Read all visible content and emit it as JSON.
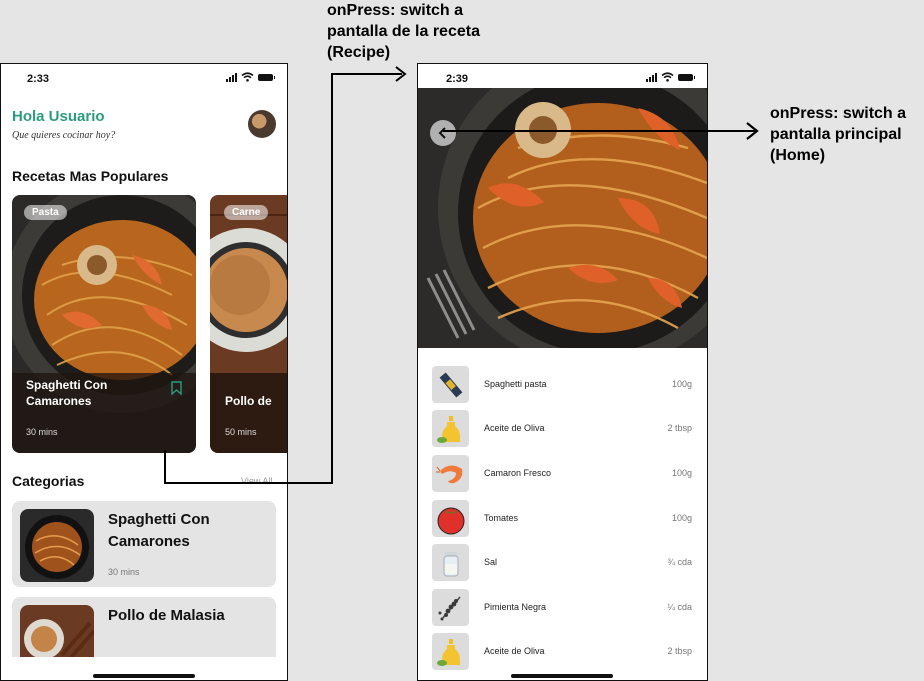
{
  "annotations": {
    "to_recipe": "onPress: switch a pantalla de la receta (Recipe)",
    "to_home": "onPress: switch a pantalla principal (Home)"
  },
  "home": {
    "status_time": "2:33",
    "greeting": "Hola Usuario",
    "subtitle": "Que quieres cocinar hoy?",
    "popular_title": "Recetas Mas Populares",
    "cards": [
      {
        "tag": "Pasta",
        "title": "Spaghetti Con Camarones",
        "time": "30 mins"
      },
      {
        "tag": "Carne",
        "title": "Pollo de",
        "time": "50 mins"
      }
    ],
    "categories_title": "Categorias",
    "view_all": "View All",
    "category_items": [
      {
        "title": "Spaghetti Con Camarones",
        "time": "30 mins"
      },
      {
        "title": "Pollo de Malasia",
        "time": ""
      }
    ]
  },
  "recipe": {
    "status_time": "2:39",
    "ingredients": [
      {
        "name": "Spaghetti pasta",
        "qty": "100g",
        "icon": "pasta-package-icon"
      },
      {
        "name": "Aceite de Oliva",
        "qty": "2 tbsp",
        "icon": "olive-oil-icon"
      },
      {
        "name": "Camaron Fresco",
        "qty": "100g",
        "icon": "shrimp-icon"
      },
      {
        "name": "Tomates",
        "qty": "100g",
        "icon": "tomato-icon"
      },
      {
        "name": "Sal",
        "qty": "¾ cda",
        "icon": "salt-icon"
      },
      {
        "name": "Pimienta Negra",
        "qty": "¼ cda",
        "icon": "pepper-icon"
      },
      {
        "name": "Aceite de Oliva",
        "qty": "2 tbsp",
        "icon": "olive-oil-icon"
      }
    ]
  },
  "colors": {
    "accent": "#2a9d7e",
    "card_bg": "#e4e4e4"
  }
}
